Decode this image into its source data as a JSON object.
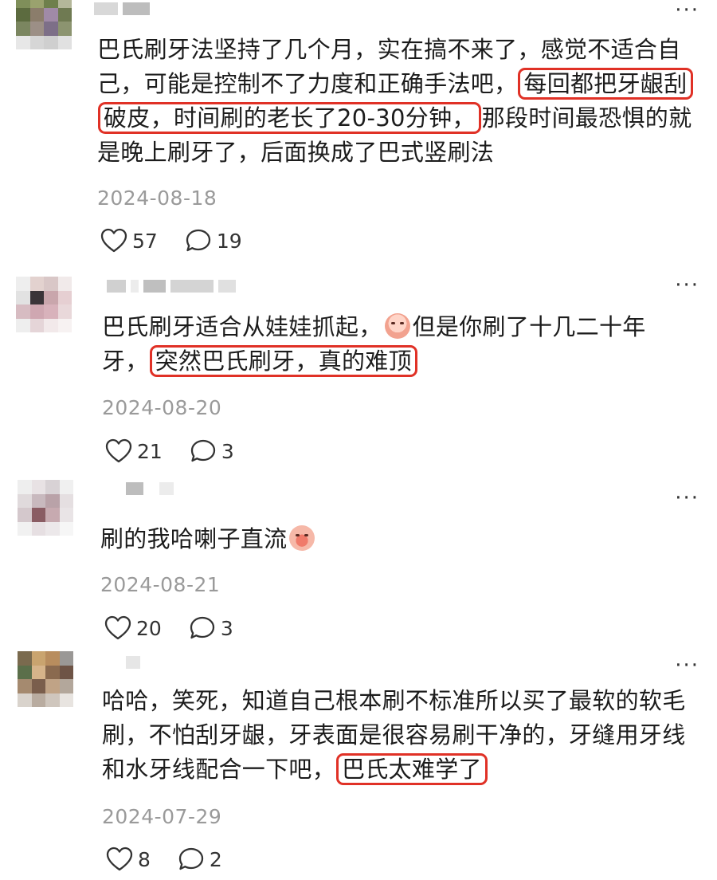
{
  "comments": [
    {
      "more": "···",
      "parts": [
        {
          "text": "巴氏刷牙法坚持了几个月，实在搞不来了，感觉不适合自己，可能是控制不了力度和正确手法吧，"
        },
        {
          "text": "每回都把牙龈刮破皮，时间刷的老长了20-30分钟，",
          "highlight": true
        },
        {
          "text": "那段时间最恐惧的就是晚上刷牙了，后面换成了巴式竖刷法"
        }
      ],
      "date": "2024-08-18",
      "likes": "57",
      "replies": "19"
    },
    {
      "more": "···",
      "parts": [
        {
          "text": "巴氏刷牙适合从娃娃抓起，"
        },
        {
          "emoji": "crying-face-emoji"
        },
        {
          "text": "但是你刷了十几二十年牙，"
        },
        {
          "text": "突然巴氏刷牙，真的难顶",
          "highlight": true
        }
      ],
      "date": "2024-08-20",
      "likes": "21",
      "replies": "3"
    },
    {
      "more": "···",
      "parts": [
        {
          "text": "刷的我哈喇子直流"
        },
        {
          "emoji": "drooling-face-emoji"
        }
      ],
      "date": "2024-08-21",
      "likes": "20",
      "replies": "3"
    },
    {
      "more": "···",
      "parts": [
        {
          "text": "哈哈，笑死，知道自己根本刷不标准所以买了最软的软毛刷，不怕刮牙龈，牙表面是很容易刷干净的，牙缝用牙线和水牙线配合一下吧，"
        },
        {
          "text": "巴氏太难学了",
          "highlight": true
        }
      ],
      "date": "2024-07-29",
      "likes": "8",
      "replies": "2"
    }
  ],
  "colors": {
    "highlight_border": "#e03126",
    "date": "#9a9a9a",
    "text": "#1c1c1c"
  },
  "icons": {
    "like": "heart-outline-icon",
    "reply": "speech-bubble-outline-icon",
    "more": "more-dots-icon"
  }
}
